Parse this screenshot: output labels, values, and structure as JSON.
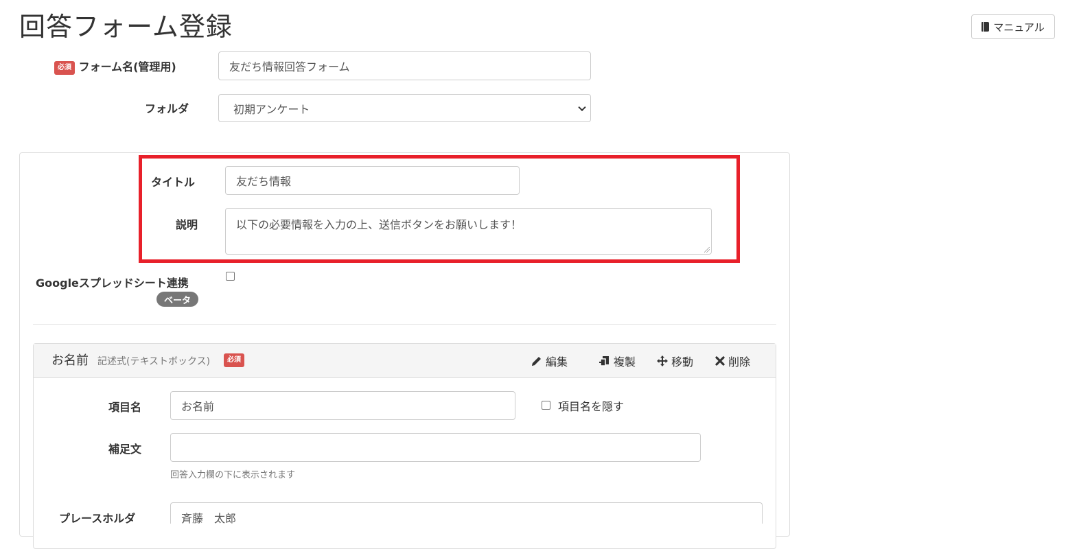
{
  "page": {
    "title": "回答フォーム登録",
    "manual_button": "マニュアル"
  },
  "badges": {
    "required": "必須",
    "beta": "ベータ"
  },
  "form": {
    "name_label": "フォーム名(管理用)",
    "name_value": "友だち情報回答フォーム",
    "folder_label": "フォルダ",
    "folder_selected": "初期アンケート",
    "title_label": "タイトル",
    "title_value": "友だち情報",
    "description_label": "説明",
    "description_value": "以下の必要情報を入力の上、送信ボタンをお願いします！",
    "spreadsheet_label": "Googleスプレッドシート連携"
  },
  "item": {
    "title": "お名前",
    "type": "記述式(テキストボックス)",
    "actions": {
      "edit": "編集",
      "duplicate": "複製",
      "move": "移動",
      "delete": "削除"
    },
    "name_label": "項目名",
    "name_value": "お名前",
    "hide_name_label": "項目名を隠す",
    "note_label": "補足文",
    "note_value": "",
    "note_help": "回答入力欄の下に表示されます",
    "placeholder_label": "プレースホルダ",
    "placeholder_value": "斉藤　太郎"
  },
  "colors": {
    "required_badge": "#d9534f",
    "highlight_border": "#e8202a",
    "beta_badge": "#777777"
  }
}
